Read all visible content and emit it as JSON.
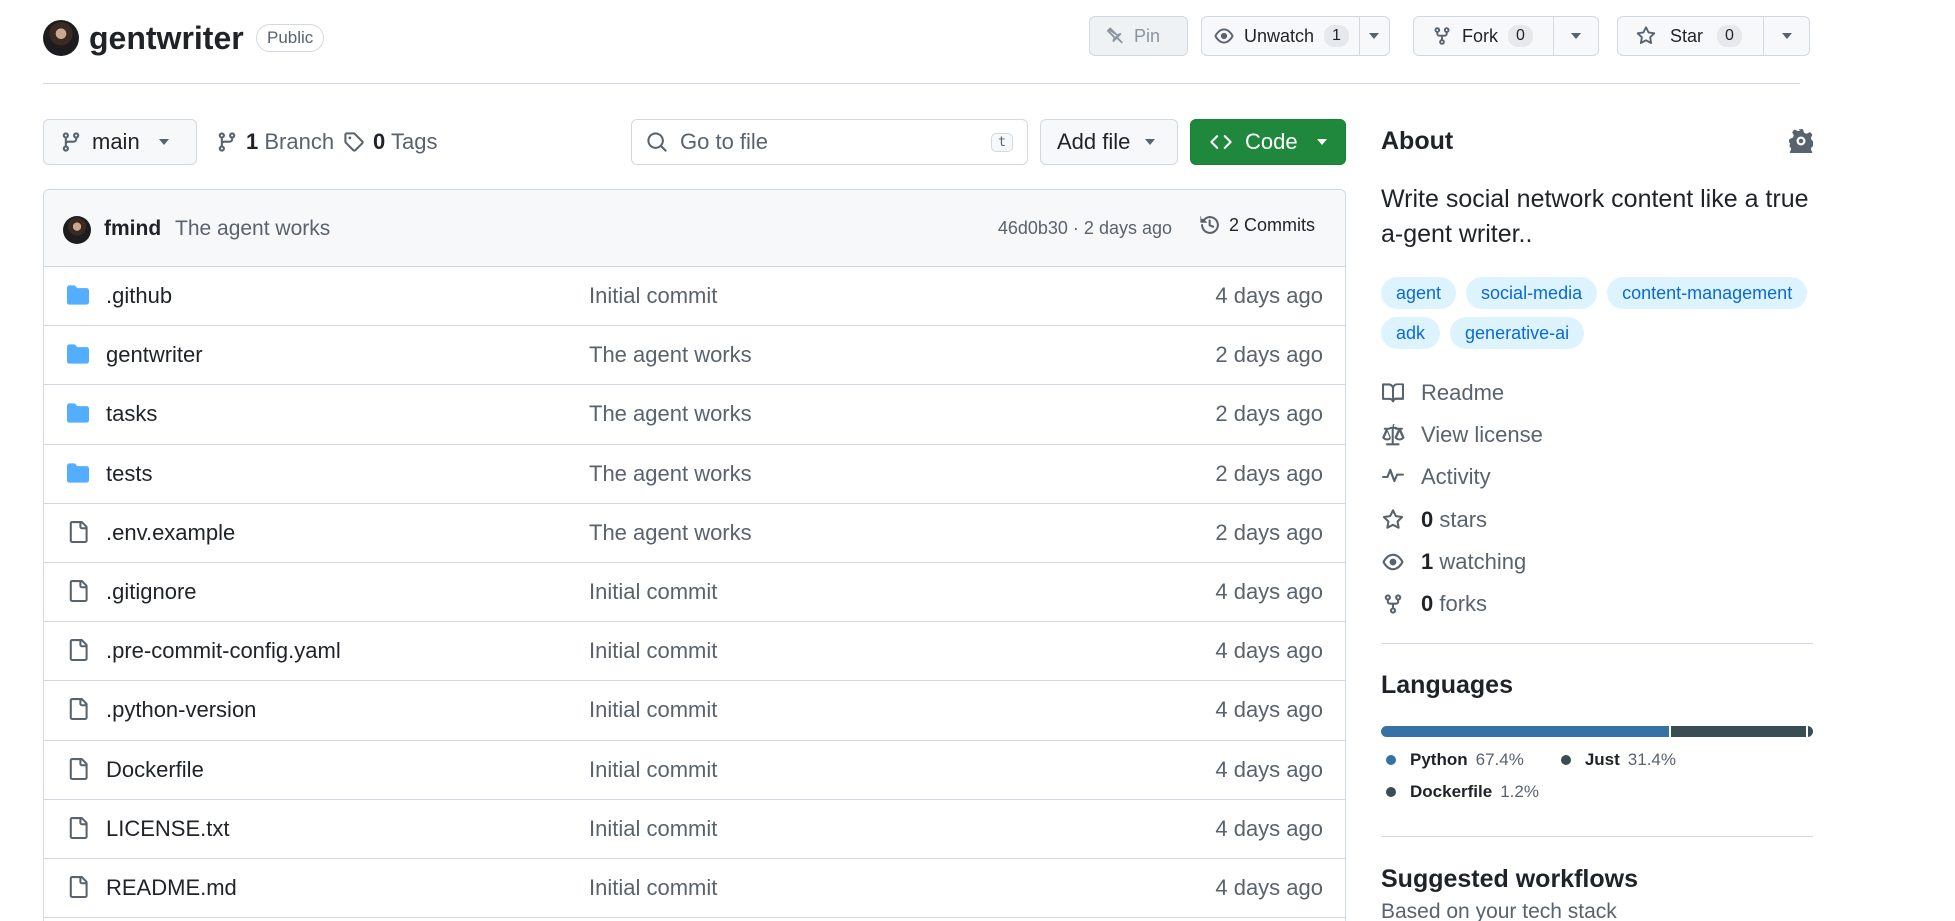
{
  "repo": {
    "name": "gentwriter",
    "visibility": "Public"
  },
  "actions": {
    "pin_label": "Pin",
    "unwatch_label": "Unwatch",
    "watch_count": "1",
    "fork_label": "Fork",
    "fork_count": "0",
    "star_label": "Star",
    "star_count": "0"
  },
  "toolbar": {
    "branch": "main",
    "branch_count": "1",
    "branch_label": "Branch",
    "tag_count": "0",
    "tag_label": "Tags",
    "search_placeholder": "Go to file",
    "search_shortcut": "t",
    "add_file_label": "Add file",
    "code_label": "Code"
  },
  "latest_commit": {
    "author": "fmind",
    "message": "The agent works",
    "meta": "46d0b30 · 2 days ago",
    "commits_label": "2 Commits"
  },
  "files": [
    {
      "name": ".github",
      "type": "dir",
      "message": "Initial commit",
      "date": "4 days ago"
    },
    {
      "name": "gentwriter",
      "type": "dir",
      "message": "The agent works",
      "date": "2 days ago"
    },
    {
      "name": "tasks",
      "type": "dir",
      "message": "The agent works",
      "date": "2 days ago"
    },
    {
      "name": "tests",
      "type": "dir",
      "message": "The agent works",
      "date": "2 days ago"
    },
    {
      "name": ".env.example",
      "type": "file",
      "message": "The agent works",
      "date": "2 days ago"
    },
    {
      "name": ".gitignore",
      "type": "file",
      "message": "Initial commit",
      "date": "4 days ago"
    },
    {
      "name": ".pre-commit-config.yaml",
      "type": "file",
      "message": "Initial commit",
      "date": "4 days ago"
    },
    {
      "name": ".python-version",
      "type": "file",
      "message": "Initial commit",
      "date": "4 days ago"
    },
    {
      "name": "Dockerfile",
      "type": "file",
      "message": "Initial commit",
      "date": "4 days ago"
    },
    {
      "name": "LICENSE.txt",
      "type": "file",
      "message": "Initial commit",
      "date": "4 days ago"
    },
    {
      "name": "README.md",
      "type": "file",
      "message": "Initial commit",
      "date": "4 days ago"
    }
  ],
  "about": {
    "title": "About",
    "description": "Write social network content like a true a-gent writer..",
    "topics": [
      "agent",
      "social-media",
      "content-management",
      "adk",
      "generative-ai"
    ],
    "links": {
      "readme": "Readme",
      "license": "View license",
      "activity": "Activity",
      "stars_count": "0",
      "stars_label": "stars",
      "watching_count": "1",
      "watching_label": "watching",
      "forks_count": "0",
      "forks_label": "forks"
    }
  },
  "languages": {
    "title": "Languages",
    "items": [
      {
        "name": "Python",
        "percent": "67.4%",
        "value": 67.4,
        "color": "#3572A5"
      },
      {
        "name": "Just",
        "percent": "31.4%",
        "value": 31.4,
        "color": "#384d54"
      },
      {
        "name": "Dockerfile",
        "percent": "1.2%",
        "value": 1.2,
        "color": "#384d54"
      }
    ]
  },
  "suggested": {
    "title": "Suggested workflows",
    "subtitle": "Based on your tech stack"
  },
  "colors": {
    "accent_green": "#1f883d",
    "link_blue": "#0969da",
    "folder_blue": "#54aeff",
    "muted": "#59636e",
    "border": "#d1d9e0"
  }
}
